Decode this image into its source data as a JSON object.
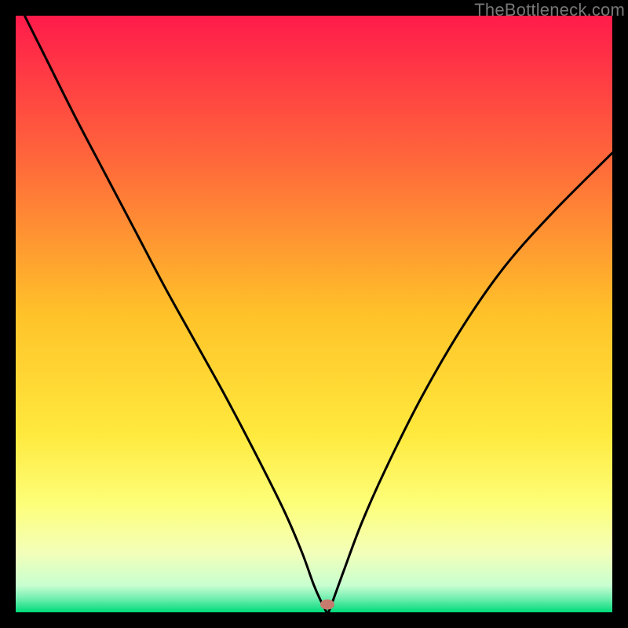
{
  "watermark": "TheBottleneck.com",
  "chart_data": {
    "type": "line",
    "title": "",
    "xlabel": "",
    "ylabel": "",
    "xlim": [
      0,
      100
    ],
    "ylim": [
      0,
      100
    ],
    "background_gradient_stops": [
      {
        "offset": 0.0,
        "color": "#ff1b4b"
      },
      {
        "offset": 0.25,
        "color": "#ff6a3a"
      },
      {
        "offset": 0.5,
        "color": "#ffc229"
      },
      {
        "offset": 0.7,
        "color": "#ffe93d"
      },
      {
        "offset": 0.82,
        "color": "#fdff7a"
      },
      {
        "offset": 0.9,
        "color": "#f3ffb9"
      },
      {
        "offset": 0.955,
        "color": "#c8ffd0"
      },
      {
        "offset": 0.975,
        "color": "#7af0b4"
      },
      {
        "offset": 1.0,
        "color": "#00db7a"
      }
    ],
    "series": [
      {
        "name": "bottleneck-curve",
        "x": [
          0,
          5,
          10,
          15,
          20,
          25,
          30,
          35,
          40,
          45,
          48,
          50,
          51.5,
          52.3,
          53,
          55,
          58,
          62,
          68,
          75,
          82,
          90,
          100
        ],
        "y": [
          103,
          93,
          83,
          73.5,
          64,
          54.5,
          45.5,
          36.5,
          27,
          17,
          10,
          4.5,
          1.2,
          0,
          1.5,
          7,
          15,
          24,
          36,
          48,
          58,
          67,
          77
        ]
      }
    ],
    "marker": {
      "x": 52.3,
      "y": 1.3,
      "color": "#c77b6e"
    }
  }
}
